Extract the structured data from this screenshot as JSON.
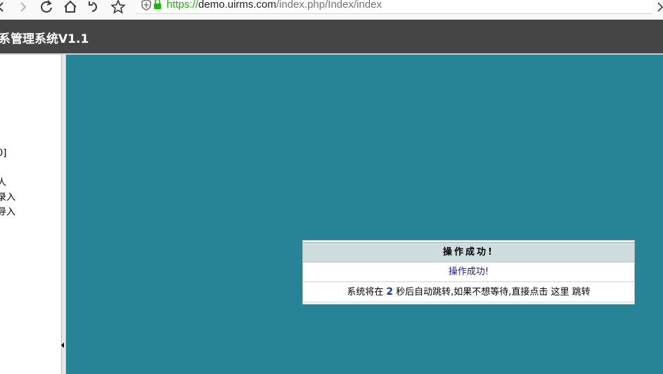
{
  "browser": {
    "url_scheme": "https://",
    "url_host": "demo.uirms.com",
    "url_path": "/index.php/Index/index"
  },
  "app": {
    "title": "系管理系统V1.1"
  },
  "sidebar": {
    "items": [
      {
        "label": "]"
      },
      {
        "label": "]"
      },
      {
        "label": "]"
      },
      {
        "label": "0]"
      },
      {
        "label": "!"
      },
      {
        "label": "人"
      },
      {
        "label": "录入"
      },
      {
        "label": "导入"
      }
    ]
  },
  "message": {
    "title": "操作成功!",
    "body": "操作成功!",
    "redirect_prefix": "系统将在",
    "countdown": "2",
    "redirect_middle": "秒后自动跳转,如果不想等待,直接点击",
    "link_here": "这里",
    "redirect_suffix": "跳转"
  },
  "colors": {
    "main_background": "#278497",
    "header_background": "#454545",
    "message_title_bg": "#cddcdc"
  }
}
